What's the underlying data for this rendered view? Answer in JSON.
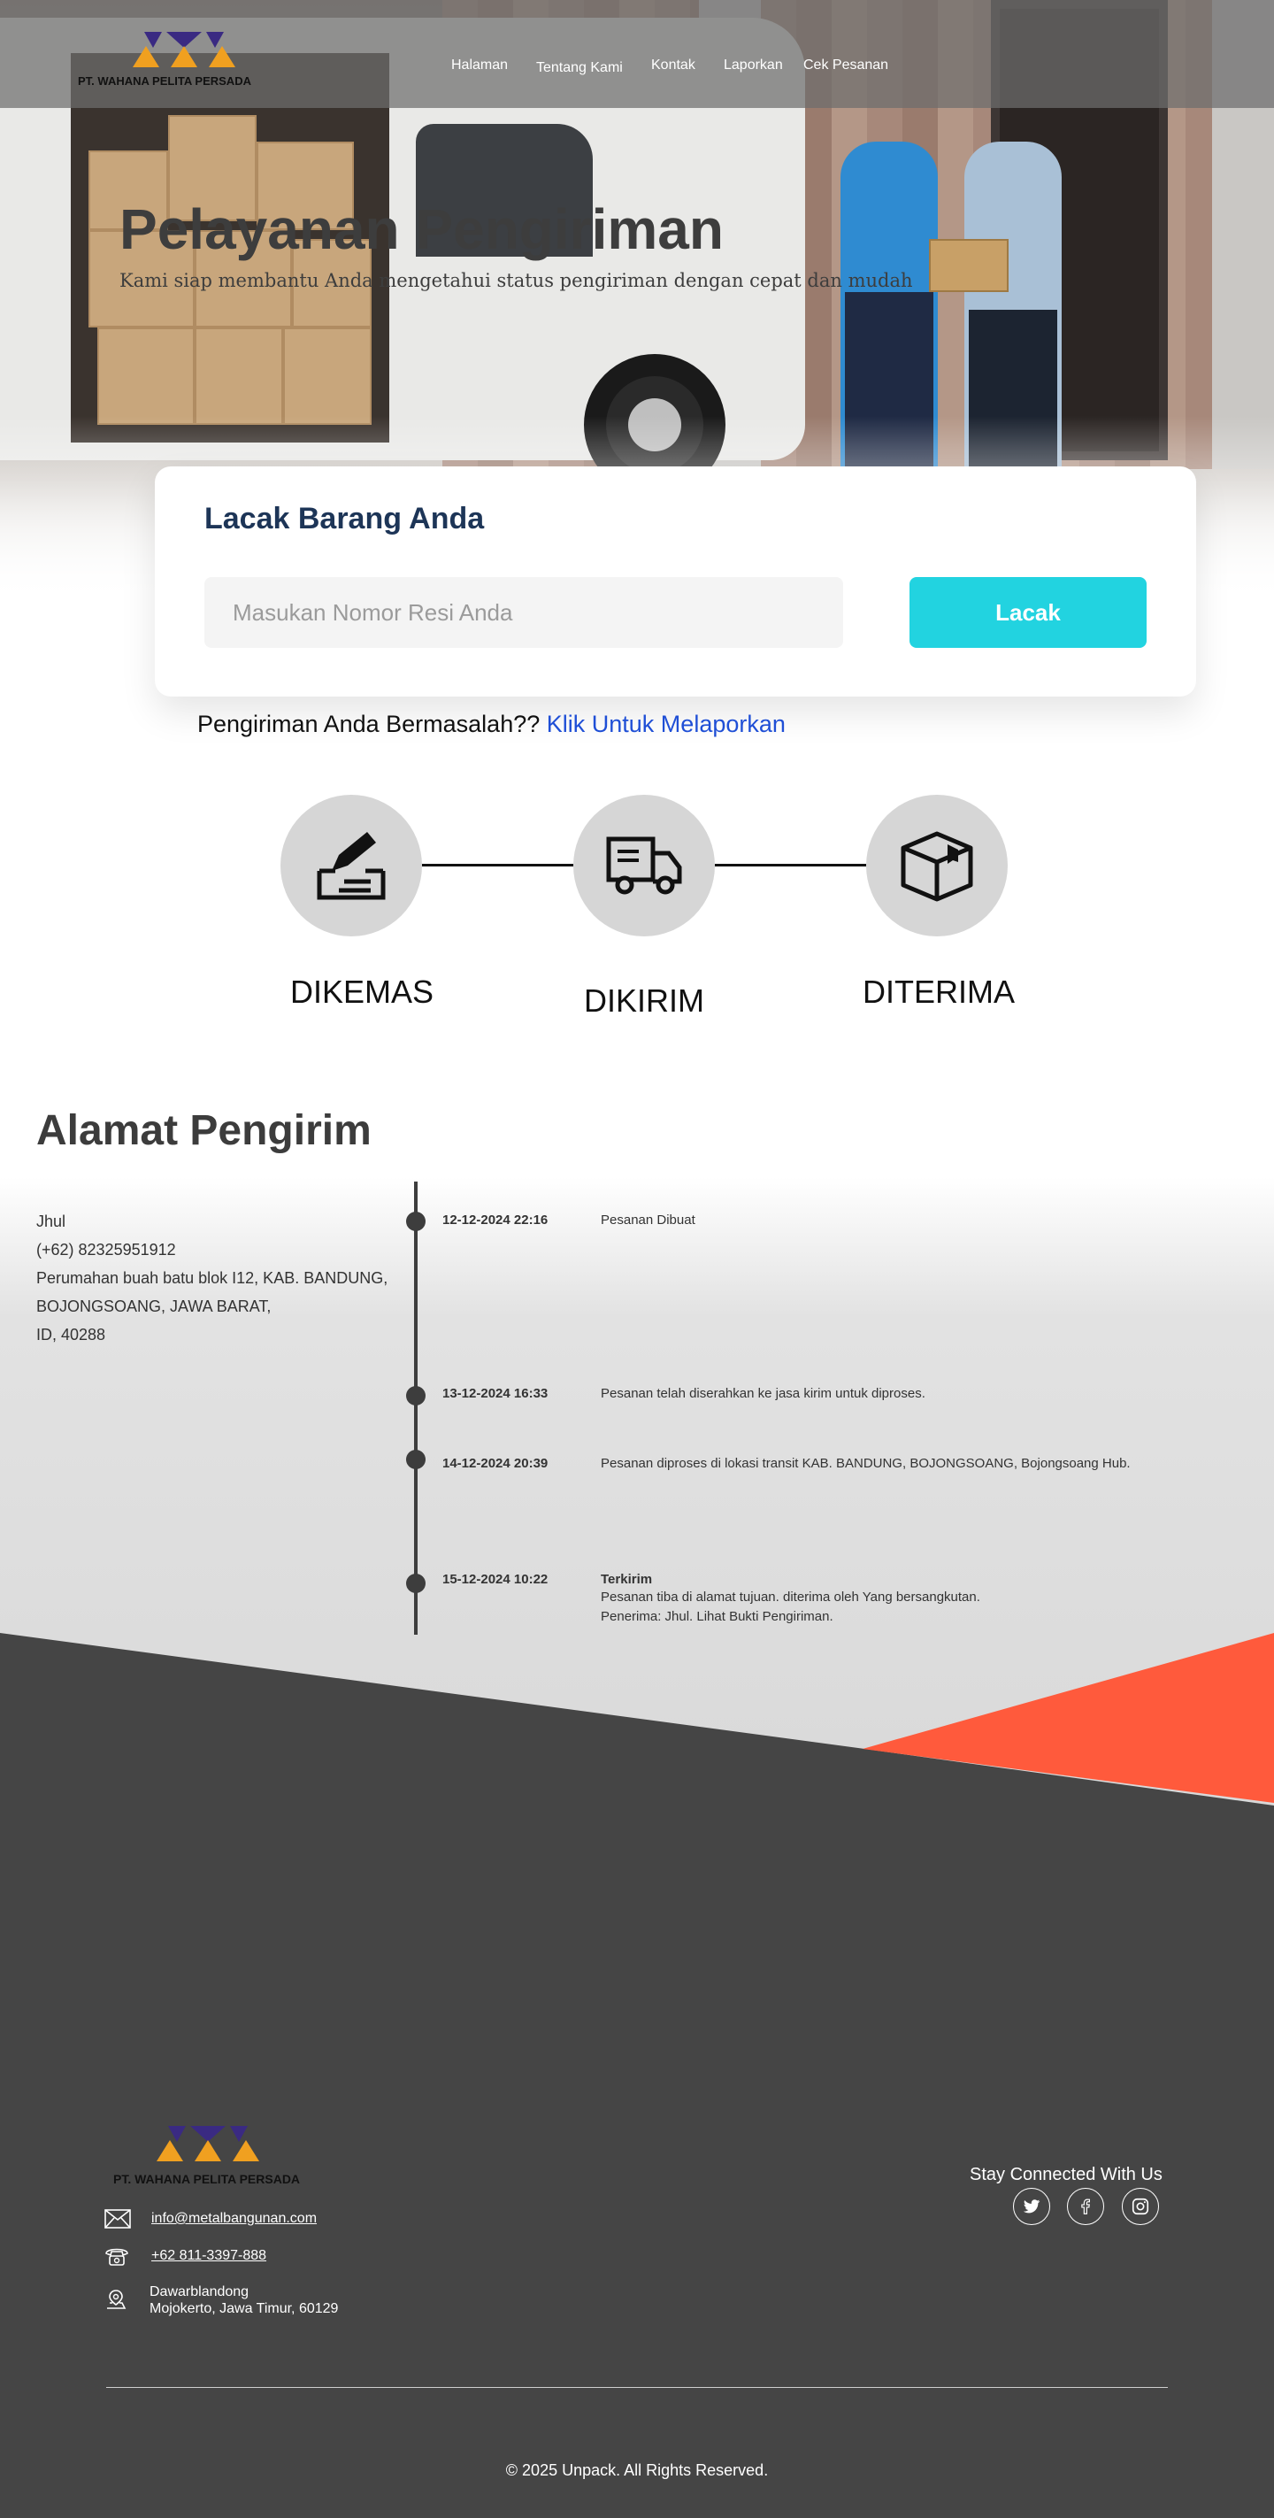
{
  "brand": {
    "name": "PT. WAHANA PELITA PERSADA",
    "colors": {
      "primary": "#3a2a82",
      "secondary": "#f0a020",
      "accent": "#22d3e0",
      "footer": "#454545",
      "orange": "#ff5a3c"
    }
  },
  "nav": {
    "items": [
      {
        "label": "Halaman"
      },
      {
        "label": "Tentang Kami"
      },
      {
        "label": "Kontak"
      },
      {
        "label": "Laporkan"
      },
      {
        "label": "Cek Pesanan"
      }
    ]
  },
  "hero": {
    "title": "Pelayanan Pengiriman",
    "subtitle": "Kami siap membantu Anda mengetahui status pengiriman dengan cepat dan mudah"
  },
  "track": {
    "title": "Lacak Barang Anda",
    "placeholder": "Masukan Nomor Resi Anda",
    "button": "Lacak"
  },
  "report": {
    "prefix": "Pengiriman Anda Bermasalah??",
    "link": "Klik Untuk Melaporkan"
  },
  "steps": [
    {
      "label": "DIKEMAS",
      "icon": "pack-icon"
    },
    {
      "label": "DIKIRIM",
      "icon": "truck-icon"
    },
    {
      "label": "DITERIMA",
      "icon": "box-icon"
    }
  ],
  "shipping": {
    "title": "Alamat Pengirim",
    "address": [
      "Jhul",
      "(+62) 82325951912",
      "Perumahan buah batu blok I12, KAB. BANDUNG,",
      "BOJONGSOANG, JAWA BARAT,",
      "ID, 40288"
    ],
    "timeline": [
      {
        "date": "12-12-2024 22:16",
        "lines": [
          "Pesanan Dibuat"
        ]
      },
      {
        "date": "13-12-2024 16:33",
        "lines": [
          "Pesanan telah diserahkan ke jasa kirim untuk diproses."
        ]
      },
      {
        "date": "14-12-2024 20:39",
        "lines": [
          "Pesanan diproses di lokasi transit KAB. BANDUNG, BOJONGSOANG, Bojongsoang Hub."
        ]
      },
      {
        "date": "15-12-2024 10:22",
        "heading": "Terkirim",
        "lines": [
          "Pesanan tiba di alamat tujuan. diterima oleh Yang bersangkutan.",
          "Penerima: Jhul. Lihat Bukti Pengiriman."
        ]
      }
    ]
  },
  "footer": {
    "email": "info@metalbangunan.com",
    "phone": "+62 811-3397-888",
    "address_line1": "Dawarblandong",
    "address_line2": "Mojokerto, Jawa Timur, 60129",
    "stay": "Stay Connected With Us",
    "social": [
      "twitter-icon",
      "facebook-icon",
      "instagram-icon"
    ],
    "copyright": "© 2025 Unpack. All Rights Reserved."
  }
}
